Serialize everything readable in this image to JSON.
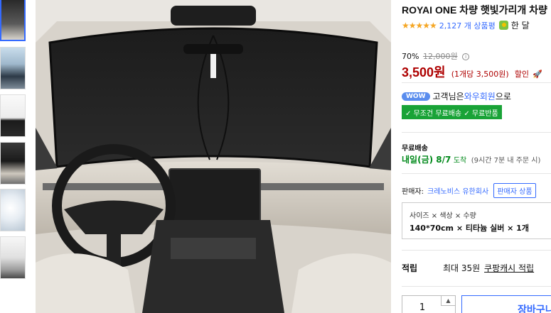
{
  "product": {
    "title": "ROYAI ONE 차량 햇빛가리개 차량",
    "rating_stars": "★★★★★",
    "review_count": "2,127 개 상품평",
    "badge_text": "한 달",
    "discount_rate": "70%",
    "original_price": "12,000원",
    "price": "3,500원",
    "unit_price": "(1개당 3,500원)",
    "sale_label": "할인",
    "wow_badge": "WOW",
    "wow_prefix": "고객님은 ",
    "wow_link": "와우회원",
    "wow_suffix": "으로",
    "shipping_badge": "✓ 무조건 무료배송 ✓ 무료반품",
    "free_shipping_label": "무료배송",
    "arrival_date": "내일(금) 8/7",
    "arrival_suffix": "도착",
    "arrival_note": "(9시간 7분 내 주문 시)",
    "seller_label": "판매자:",
    "seller_name": "크레노비스 유한회사",
    "seller_button": "판매자 상품",
    "option_labels": "사이즈 × 색상 × 수량",
    "option_values": "140*70cm × 티타늄 실버 × 1개",
    "points_label": "적립",
    "points_text": "최대 35원",
    "points_link": "쿠팡캐시 적립",
    "quantity": "1",
    "cart_button": "장바구니"
  },
  "icons": {
    "info": "info-icon",
    "rocket": "rocket-icon",
    "badge": "guarantee-badge-icon",
    "qty_up": "chevron-up-icon"
  },
  "colors": {
    "price": "#ae0000",
    "link": "#346aff",
    "shipping_badge": "#19a337",
    "arrival": "#00891a",
    "stars": "#f5a623"
  }
}
